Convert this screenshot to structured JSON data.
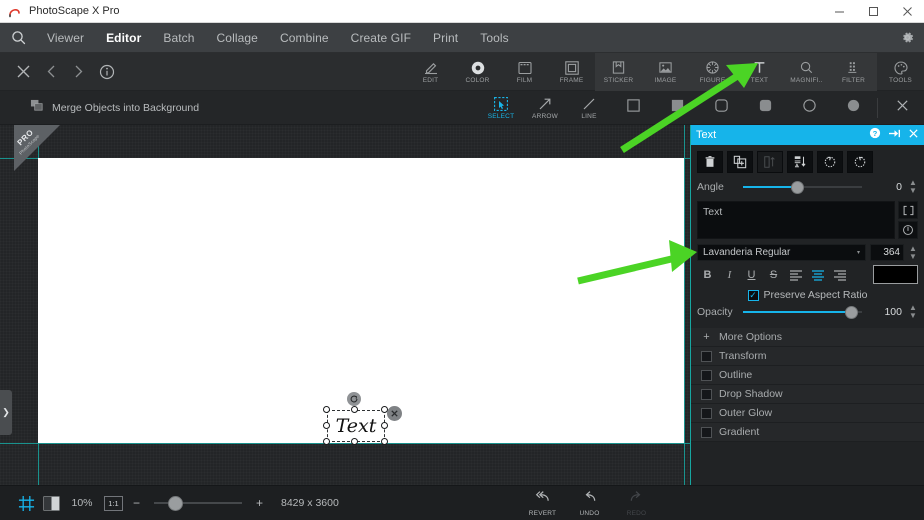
{
  "window": {
    "title": "PhotoScape X Pro",
    "app_icon": "photoscape-logo-icon",
    "minimize": "−",
    "maximize": "□",
    "close": "✕"
  },
  "menubar": {
    "logo_icon": "magnifier-logo-icon",
    "items": [
      {
        "label": "Viewer",
        "active": false
      },
      {
        "label": "Editor",
        "active": true
      },
      {
        "label": "Batch",
        "active": false
      },
      {
        "label": "Collage",
        "active": false
      },
      {
        "label": "Combine",
        "active": false
      },
      {
        "label": "Create GIF",
        "active": false
      },
      {
        "label": "Print",
        "active": false
      },
      {
        "label": "Tools",
        "active": false
      }
    ],
    "settings_icon": "gear-icon"
  },
  "toolbar": {
    "left_icons": [
      "close-icon",
      "chevron-left-icon",
      "chevron-right-icon",
      "info-icon"
    ],
    "tools": [
      {
        "label": "EDIT",
        "icon": "edit-icon",
        "grouped": false
      },
      {
        "label": "COLOR",
        "icon": "color-ring-icon",
        "grouped": false
      },
      {
        "label": "FILM",
        "icon": "film-icon",
        "grouped": false
      },
      {
        "label": "FRAME",
        "icon": "frame-icon",
        "grouped": false
      },
      {
        "label": "STICKER",
        "icon": "sticker-icon",
        "grouped": true
      },
      {
        "label": "IMAGE",
        "icon": "image-icon",
        "grouped": true
      },
      {
        "label": "FIGURE",
        "icon": "figure-icon",
        "grouped": true
      },
      {
        "label": "TEXT",
        "icon": "text-t-icon",
        "grouped": true
      },
      {
        "label": "MAGNIFI..",
        "icon": "magnifier-icon",
        "grouped": true
      },
      {
        "label": "FILTER",
        "icon": "filter-icon",
        "grouped": true
      },
      {
        "label": "TOOLS",
        "icon": "palette-icon",
        "grouped": false
      }
    ]
  },
  "subbar": {
    "merge_label": "Merge Objects into Background",
    "merge_icon": "merge-layers-icon",
    "tools": [
      {
        "label": "SELECT",
        "icon": "select-marquee-icon",
        "selected": true
      },
      {
        "label": "ARROW",
        "icon": "arrow-icon",
        "selected": false
      },
      {
        "label": "LINE",
        "icon": "line-icon",
        "selected": false
      }
    ],
    "shapes": [
      {
        "name": "square-outline-icon"
      },
      {
        "name": "square-filled-icon"
      },
      {
        "name": "rounded-square-outline-icon"
      },
      {
        "name": "rounded-square-filled-icon"
      },
      {
        "name": "circle-outline-icon"
      },
      {
        "name": "circle-filled-icon"
      }
    ],
    "close_icon": "close-icon"
  },
  "canvas": {
    "pro_badge": "PRO",
    "pro_badge_sub": "PhotoScape",
    "object_text": "Text",
    "rotate_icon": "rotate-handle-icon",
    "delete_icon": "delete-object-icon",
    "collapse_icon": "chevron-right-icon"
  },
  "panel": {
    "title": "Text",
    "help_icon": "help-icon",
    "pin_icon": "pin-icon",
    "close_icon": "close-icon",
    "object_buttons": [
      {
        "name": "delete-object-button",
        "icon": "trash-icon",
        "enabled": true
      },
      {
        "name": "duplicate-object-button",
        "icon": "duplicate-icon",
        "enabled": true
      },
      {
        "name": "flip-vertical-button",
        "icon": "flip-vertical-icon",
        "enabled": false
      },
      {
        "name": "arrange-order-button",
        "icon": "arrange-down-icon",
        "enabled": true
      },
      {
        "name": "rotate-left-button",
        "icon": "rotate-left-icon",
        "enabled": true
      },
      {
        "name": "rotate-right-button",
        "icon": "rotate-right-icon",
        "enabled": true
      }
    ],
    "angle": {
      "label": "Angle",
      "value": "0",
      "percent": 45
    },
    "text_value": "Text",
    "text_placeholder": "Text",
    "text_side_buttons": [
      {
        "name": "text-bounds-button",
        "icon": "brackets-icon"
      },
      {
        "name": "text-info-button",
        "icon": "circle-bar-icon"
      }
    ],
    "font": {
      "family": "Lavanderia Regular",
      "size": "364",
      "caret": "▾"
    },
    "format_buttons": [
      {
        "name": "bold-button",
        "glyph": "B",
        "active": false
      },
      {
        "name": "italic-button",
        "glyph": "I",
        "active": false
      },
      {
        "name": "underline-button",
        "glyph": "U",
        "active": false
      },
      {
        "name": "strikethrough-button",
        "glyph": "S",
        "active": false
      },
      {
        "name": "align-left-button",
        "glyph": "align-left-icon",
        "active": false
      },
      {
        "name": "align-center-button",
        "glyph": "align-center-icon",
        "active": true
      },
      {
        "name": "align-right-button",
        "glyph": "align-right-icon",
        "active": false
      }
    ],
    "color_swatch": "#000000",
    "preserve_aspect": {
      "label": "Preserve Aspect Ratio",
      "checked": true
    },
    "opacity": {
      "label": "Opacity",
      "value": "100",
      "percent": 92
    },
    "options": [
      {
        "label": "More Options",
        "type": "plus",
        "checked": false
      },
      {
        "label": "Transform",
        "type": "checkbox",
        "checked": false
      },
      {
        "label": "Outline",
        "type": "checkbox",
        "checked": false
      },
      {
        "label": "Drop Shadow",
        "type": "checkbox",
        "checked": false
      },
      {
        "label": "Outer Glow",
        "type": "checkbox",
        "checked": false
      },
      {
        "label": "Gradient",
        "type": "checkbox",
        "checked": false
      }
    ]
  },
  "statusbar": {
    "grid_icon": "grid-icon",
    "split_icon": "split-view-icon",
    "zoom_percent": "10%",
    "actual_size_label": "1:1",
    "zoom_out": "−",
    "zoom_in": "+",
    "dimensions": "8429 x 3600",
    "actions": [
      {
        "label": "REVERT",
        "icon": "revert-icon",
        "enabled": true
      },
      {
        "label": "UNDO",
        "icon": "undo-icon",
        "enabled": true
      },
      {
        "label": "REDO",
        "icon": "redo-icon",
        "enabled": false
      }
    ]
  },
  "annotations": {
    "arrow_color": "#4bd425",
    "arrow_text_tool": "arrow-pointing-to-text-tool",
    "arrow_font_field": "arrow-pointing-to-font-field"
  }
}
